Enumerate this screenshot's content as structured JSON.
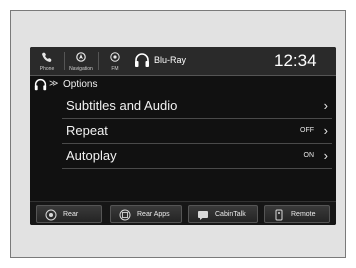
{
  "top": {
    "sources": [
      {
        "label": "Phone",
        "icon": "phone-icon"
      },
      {
        "label": "Navigation",
        "icon": "navigation-icon"
      },
      {
        "label": "FM",
        "icon": "radio-icon"
      }
    ],
    "now_playing_icon": "headphones-icon",
    "now_playing": "Blu-Ray",
    "clock": "12:34"
  },
  "breadcrumb": {
    "icon": "headphones-icon",
    "chevron": "≫",
    "title": "Options"
  },
  "options": [
    {
      "label": "Subtitles and Audio",
      "value": ""
    },
    {
      "label": "Repeat",
      "value": "OFF"
    },
    {
      "label": "Autoplay",
      "value": "ON"
    }
  ],
  "bottom": [
    {
      "label": "Rear",
      "icon": "rear-icon"
    },
    {
      "label": "Rear Apps",
      "icon": "rear-apps-icon"
    },
    {
      "label": "CabinTalk",
      "icon": "cabintalk-icon"
    },
    {
      "label": "Remote",
      "icon": "remote-icon"
    }
  ]
}
